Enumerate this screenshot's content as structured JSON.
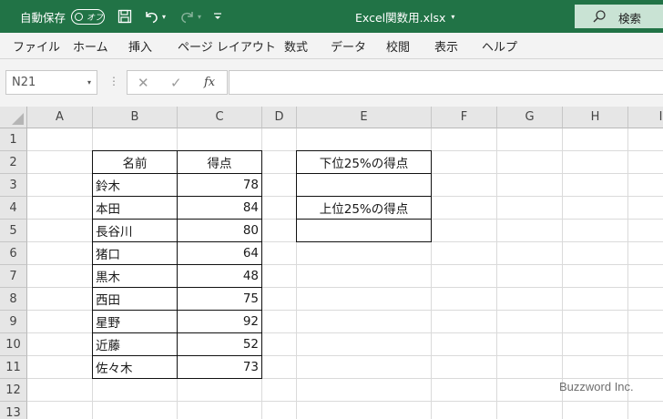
{
  "titlebar": {
    "autosave_label": "自動保存",
    "autosave_state": "オフ",
    "document_title": "Excel関数用.xlsx",
    "search_label": "検索",
    "brand_color": "#217346"
  },
  "ribbon": {
    "tabs": [
      "ファイル",
      "ホーム",
      "挿入",
      "ページ レイアウト",
      "数式",
      "データ",
      "校閲",
      "表示",
      "ヘルプ"
    ]
  },
  "formula_bar": {
    "name_box": "N21",
    "fx_label": "fx",
    "formula": ""
  },
  "sheet": {
    "columns": [
      "A",
      "B",
      "C",
      "D",
      "E",
      "F",
      "G",
      "H",
      "I"
    ],
    "rows": [
      "1",
      "2",
      "3",
      "4",
      "5",
      "6",
      "7",
      "8",
      "9",
      "10",
      "11",
      "12",
      "13"
    ],
    "table": {
      "headers": [
        "名前",
        "得点"
      ],
      "records": [
        {
          "name": "鈴木",
          "score": "78"
        },
        {
          "name": "本田",
          "score": "84"
        },
        {
          "name": "長谷川",
          "score": "80"
        },
        {
          "name": "猪口",
          "score": "64"
        },
        {
          "name": "黒木",
          "score": "48"
        },
        {
          "name": "西田",
          "score": "75"
        },
        {
          "name": "星野",
          "score": "92"
        },
        {
          "name": "近藤",
          "score": "52"
        },
        {
          "name": "佐々木",
          "score": "73"
        }
      ]
    },
    "results": {
      "lower_label": "下位25%の得点",
      "lower_value": "",
      "upper_label": "上位25%の得点",
      "upper_value": ""
    }
  },
  "watermark": "Buzzword Inc."
}
